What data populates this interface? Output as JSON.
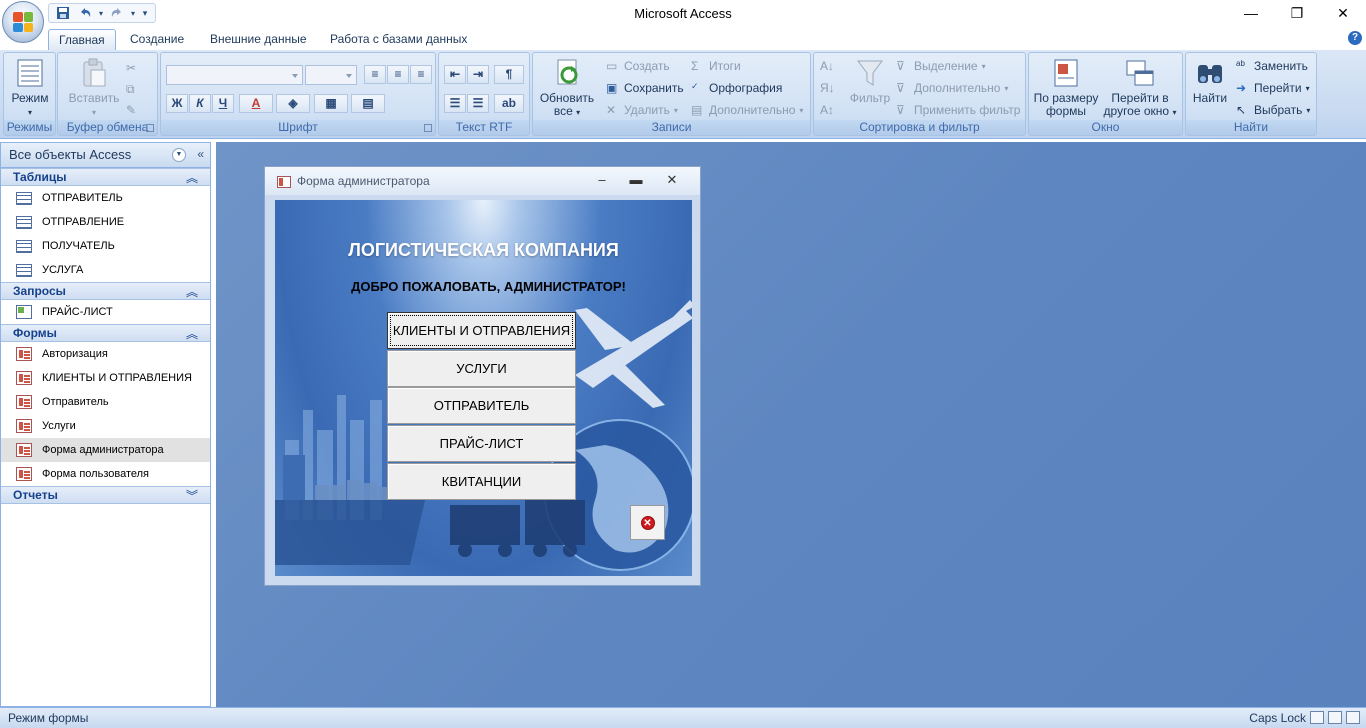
{
  "app": {
    "title": "Microsoft Access"
  },
  "quick_access": {
    "save_icon": "save-icon",
    "undo_icon": "undo-icon",
    "redo_icon": "redo-icon",
    "customize_icon": "chevron-down-icon"
  },
  "tabs": [
    {
      "label": "Главная",
      "active": true
    },
    {
      "label": "Создание",
      "active": false
    },
    {
      "label": "Внешние данные",
      "active": false
    },
    {
      "label": "Работа с базами данных",
      "active": false
    }
  ],
  "ribbon": {
    "views": {
      "button": "Режим",
      "group": "Режимы"
    },
    "clipboard": {
      "paste": "Вставить",
      "group": "Буфер обмена"
    },
    "font": {
      "group": "Шрифт",
      "bold": "Ж",
      "italic": "К",
      "underline": "Ч",
      "font_color": "A"
    },
    "rtf": {
      "group": "Текст RTF"
    },
    "records": {
      "refresh": "Обновить",
      "refresh2": "все",
      "new": "Создать",
      "save": "Сохранить",
      "delete": "Удалить",
      "totals": "Итоги",
      "spelling": "Орфография",
      "more": "Дополнительно",
      "group": "Записи"
    },
    "sort_filter": {
      "filter": "Фильтр",
      "selection": "Выделение",
      "advanced": "Дополнительно",
      "toggle": "Применить фильтр",
      "group": "Сортировка и фильтр"
    },
    "window": {
      "fit": "По размеру",
      "fit2": "формы",
      "switch": "Перейти в",
      "switch2": "другое окно",
      "group": "Окно"
    },
    "find": {
      "find": "Найти",
      "replace": "Заменить",
      "goto": "Перейти",
      "select": "Выбрать",
      "group": "Найти"
    }
  },
  "nav": {
    "header": "Все объекты Access",
    "sections": {
      "tables": {
        "label": "Таблицы",
        "items": [
          "ОТПРАВИТЕЛЬ",
          "ОТПРАВЛЕНИЕ",
          "ПОЛУЧАТЕЛЬ",
          "УСЛУГА"
        ]
      },
      "queries": {
        "label": "Запросы",
        "items": [
          "ПРАЙС-ЛИСТ"
        ]
      },
      "forms": {
        "label": "Формы",
        "items": [
          "Авторизация",
          "КЛИЕНТЫ И ОТПРАВЛЕНИЯ",
          "Отправитель",
          "Услуги",
          "Форма администратора",
          "Форма пользователя"
        ],
        "selected_index": 4
      },
      "reports": {
        "label": "Отчеты"
      }
    }
  },
  "form": {
    "title": "Форма администратора",
    "banner": "ЛОГИСТИЧЕСКАЯ КОМПАНИЯ",
    "welcome": "ДОБРО ПОЖАЛОВАТЬ, АДМИНИСТРАТОР!",
    "buttons": [
      "КЛИЕНТЫ И ОТПРАВЛЕНИЯ",
      "УСЛУГИ",
      "ОТПРАВИТЕЛЬ",
      "ПРАЙС-ЛИСТ",
      "КВИТАНЦИИ"
    ],
    "close_icon": "close-circle-icon"
  },
  "status": {
    "mode": "Режим формы",
    "caps": "Caps Lock"
  }
}
